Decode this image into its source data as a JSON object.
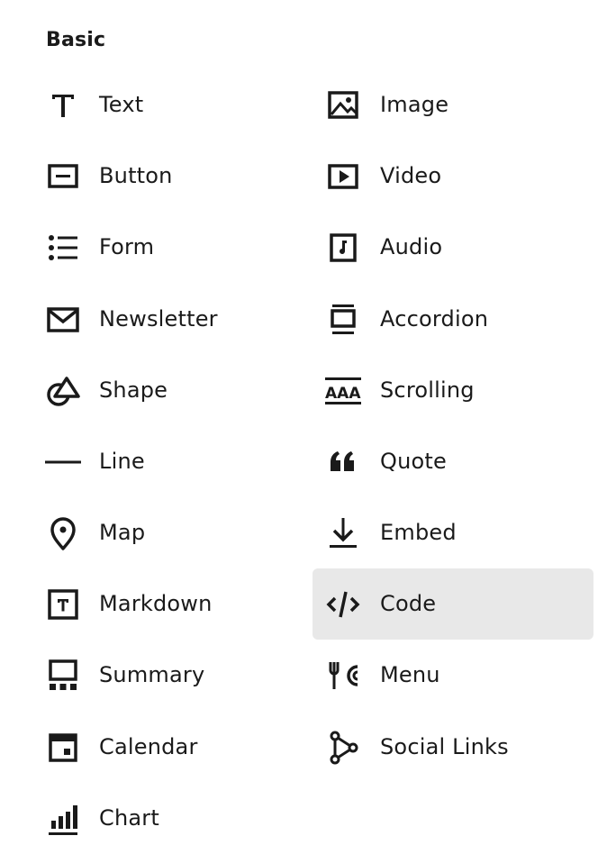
{
  "section_title": "Basic",
  "items": [
    {
      "label": "Text",
      "icon": "text-icon"
    },
    {
      "label": "Image",
      "icon": "image-icon"
    },
    {
      "label": "Button",
      "icon": "button-icon"
    },
    {
      "label": "Video",
      "icon": "video-icon"
    },
    {
      "label": "Form",
      "icon": "form-icon"
    },
    {
      "label": "Audio",
      "icon": "audio-icon"
    },
    {
      "label": "Newsletter",
      "icon": "newsletter-icon"
    },
    {
      "label": "Accordion",
      "icon": "accordion-icon"
    },
    {
      "label": "Shape",
      "icon": "shape-icon"
    },
    {
      "label": "Scrolling",
      "icon": "scrolling-icon"
    },
    {
      "label": "Line",
      "icon": "line-icon"
    },
    {
      "label": "Quote",
      "icon": "quote-icon"
    },
    {
      "label": "Map",
      "icon": "map-pin-icon"
    },
    {
      "label": "Embed",
      "icon": "embed-icon"
    },
    {
      "label": "Markdown",
      "icon": "markdown-icon"
    },
    {
      "label": "Code",
      "icon": "code-icon",
      "selected": true
    },
    {
      "label": "Summary",
      "icon": "summary-icon"
    },
    {
      "label": "Menu",
      "icon": "menu-icon"
    },
    {
      "label": "Calendar",
      "icon": "calendar-icon"
    },
    {
      "label": "Social Links",
      "icon": "social-links-icon"
    },
    {
      "label": "Chart",
      "icon": "chart-icon"
    }
  ],
  "colors": {
    "text": "#1a1a1a",
    "selected_background": "#e8e8e8"
  }
}
